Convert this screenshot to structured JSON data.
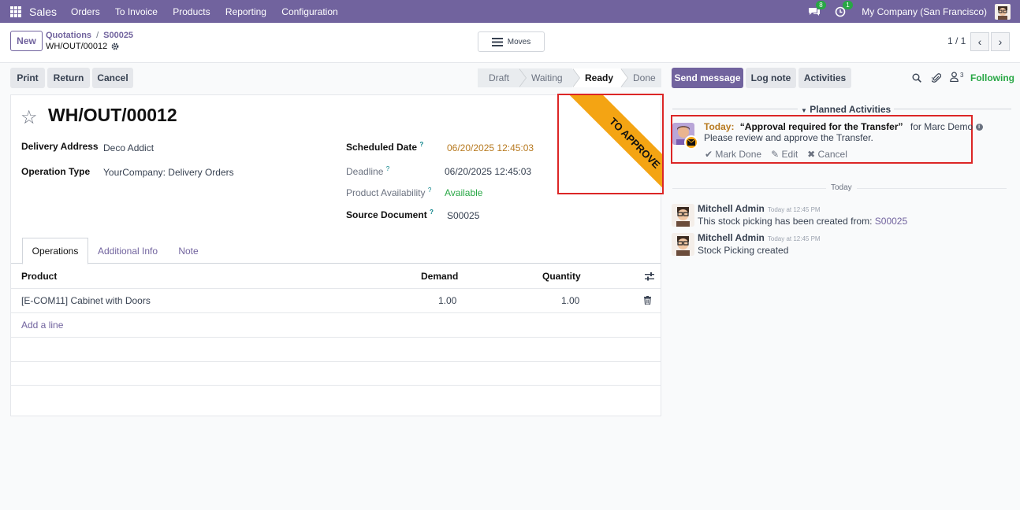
{
  "navbar": {
    "app_name": "Sales",
    "menu": [
      "Orders",
      "To Invoice",
      "Products",
      "Reporting",
      "Configuration"
    ],
    "messages_count": "8",
    "activities_count": "1",
    "company": "My Company (San Francisco)"
  },
  "control_panel": {
    "new_label": "New",
    "breadcrumb": [
      "Quotations",
      "S00025"
    ],
    "record_name": "WH/OUT/00012",
    "moves_label": "Moves",
    "pager": "1 / 1"
  },
  "statusbar": {
    "buttons": [
      "Print",
      "Return",
      "Cancel"
    ],
    "stages": [
      "Draft",
      "Waiting",
      "Ready",
      "Done"
    ],
    "active_stage": "Ready"
  },
  "form": {
    "title": "WH/OUT/00012",
    "ribbon": "TO APPROVE",
    "delivery_address_label": "Delivery Address",
    "delivery_address": "Deco Addict",
    "operation_type_label": "Operation Type",
    "operation_type": "YourCompany: Delivery Orders",
    "scheduled_date_label": "Scheduled Date",
    "scheduled_date": "06/20/2025 12:45:03",
    "deadline_label": "Deadline",
    "deadline": "06/20/2025 12:45:03",
    "availability_label": "Product Availability",
    "availability": "Available",
    "source_document_label": "Source Document",
    "source_document": "S00025",
    "help_mark": "?",
    "tabs": [
      "Operations",
      "Additional Info",
      "Note"
    ],
    "table": {
      "headers": [
        "Product",
        "Demand",
        "Quantity"
      ],
      "rows": [
        {
          "product": "[E-COM11] Cabinet with Doors",
          "demand": "1.00",
          "quantity": "1.00"
        }
      ],
      "add_line": "Add a line"
    }
  },
  "chatter": {
    "send_message": "Send message",
    "log_note": "Log note",
    "activities": "Activities",
    "followers_count": "3",
    "following": "Following",
    "planned_title": "Planned Activities",
    "activity": {
      "due": "Today:",
      "summary": "“Approval required for the Transfer”",
      "assignee": "for Marc Demo",
      "note": "Please review and approve the Transfer.",
      "mark_done": "Mark Done",
      "edit": "Edit",
      "cancel": "Cancel"
    },
    "day_separator": "Today",
    "messages": [
      {
        "author": "Mitchell Admin",
        "time": "Today at 12:45 PM",
        "body": "This stock picking has been created from:",
        "link": "S00025"
      },
      {
        "author": "Mitchell Admin",
        "time": "Today at 12:45 PM",
        "body": "Stock Picking created"
      }
    ]
  },
  "colors": {
    "brand": "#71639e",
    "ribbon": "#f4a413",
    "highlight": "#dc2626",
    "success": "#28a745"
  }
}
